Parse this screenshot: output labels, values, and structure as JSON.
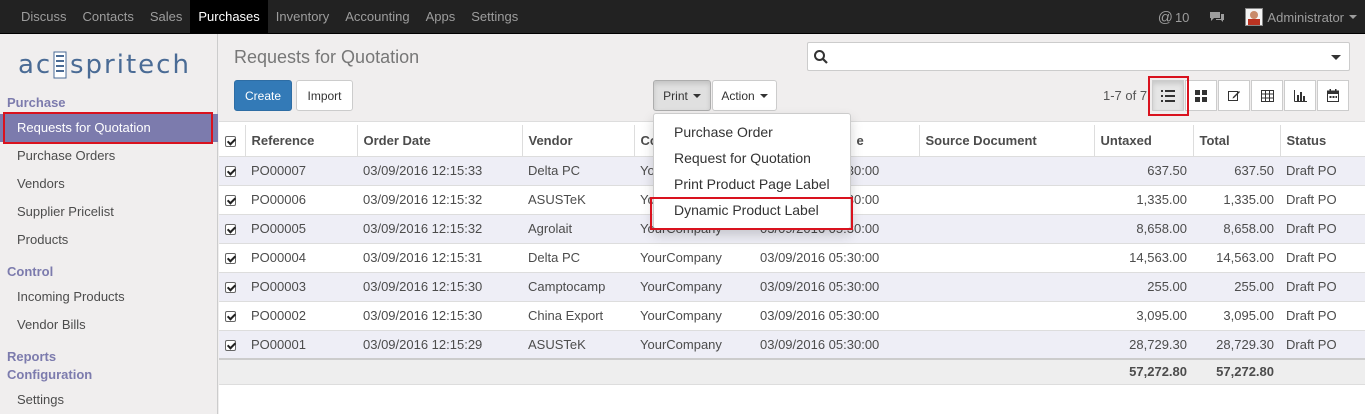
{
  "nav": {
    "items": [
      "Discuss",
      "Contacts",
      "Sales",
      "Purchases",
      "Inventory",
      "Accounting",
      "Apps",
      "Settings"
    ],
    "active_index": 3,
    "notifications_count": "10",
    "user": "Administrator"
  },
  "sidebar": {
    "sections": {
      "purchase": "Purchase",
      "control": "Control",
      "reports": "Reports",
      "configuration": "Configuration"
    },
    "purchase_items": [
      "Requests for Quotation",
      "Purchase Orders",
      "Vendors",
      "Supplier Pricelist",
      "Products"
    ],
    "control_items": [
      "Incoming Products",
      "Vendor Bills"
    ],
    "configuration_items": [
      "Settings"
    ]
  },
  "logo_text": "acspritech",
  "page": {
    "title": "Requests for Quotation",
    "create_label": "Create",
    "import_label": "Import",
    "print_label": "Print",
    "action_label": "Action",
    "pager": "1-7 of 7"
  },
  "print_menu": [
    "Purchase Order",
    "Request for Quotation",
    "Print Product Page Label",
    "Dynamic Product Label"
  ],
  "table": {
    "columns": [
      "Reference",
      "Order Date",
      "Vendor",
      "Company",
      "Scheduled Date",
      "Source Document",
      "Untaxed",
      "Total",
      "Status"
    ],
    "visible_headers": [
      "Reference",
      "Order Date",
      "Vendor",
      "Co",
      "e",
      "Source Document",
      "Untaxed",
      "Total",
      "Status"
    ],
    "rows": [
      [
        "PO00007",
        "03/09/2016 12:15:33",
        "Delta PC",
        "YourCompany",
        "03/09/2016 05:30:00",
        "",
        "637.50",
        "637.50",
        "Draft PO"
      ],
      [
        "PO00006",
        "03/09/2016 12:15:32",
        "ASUSTeK",
        "YourCompany",
        "03/09/2016 05:30:00",
        "",
        "1,335.00",
        "1,335.00",
        "Draft PO"
      ],
      [
        "PO00005",
        "03/09/2016 12:15:32",
        "Agrolait",
        "YourCompany",
        "03/09/2016 05:30:00",
        "",
        "8,658.00",
        "8,658.00",
        "Draft PO"
      ],
      [
        "PO00004",
        "03/09/2016 12:15:31",
        "Delta PC",
        "YourCompany",
        "03/09/2016 05:30:00",
        "",
        "14,563.00",
        "14,563.00",
        "Draft PO"
      ],
      [
        "PO00003",
        "03/09/2016 12:15:30",
        "Camptocamp",
        "YourCompany",
        "03/09/2016 05:30:00",
        "",
        "255.00",
        "255.00",
        "Draft PO"
      ],
      [
        "PO00002",
        "03/09/2016 12:15:30",
        "China Export",
        "YourCompany",
        "03/09/2016 05:30:00",
        "",
        "3,095.00",
        "3,095.00",
        "Draft PO"
      ],
      [
        "PO00001",
        "03/09/2016 12:15:29",
        "ASUSTeK",
        "YourCompany",
        "03/09/2016 05:30:00",
        "",
        "28,729.30",
        "28,729.30",
        "Draft PO"
      ]
    ],
    "totals": {
      "untaxed": "57,272.80",
      "total": "57,272.80"
    }
  },
  "colors": {
    "accent": "#7c7bad",
    "primary": "#337ab7",
    "highlight": "#d9121e",
    "topbar": "#222222"
  }
}
